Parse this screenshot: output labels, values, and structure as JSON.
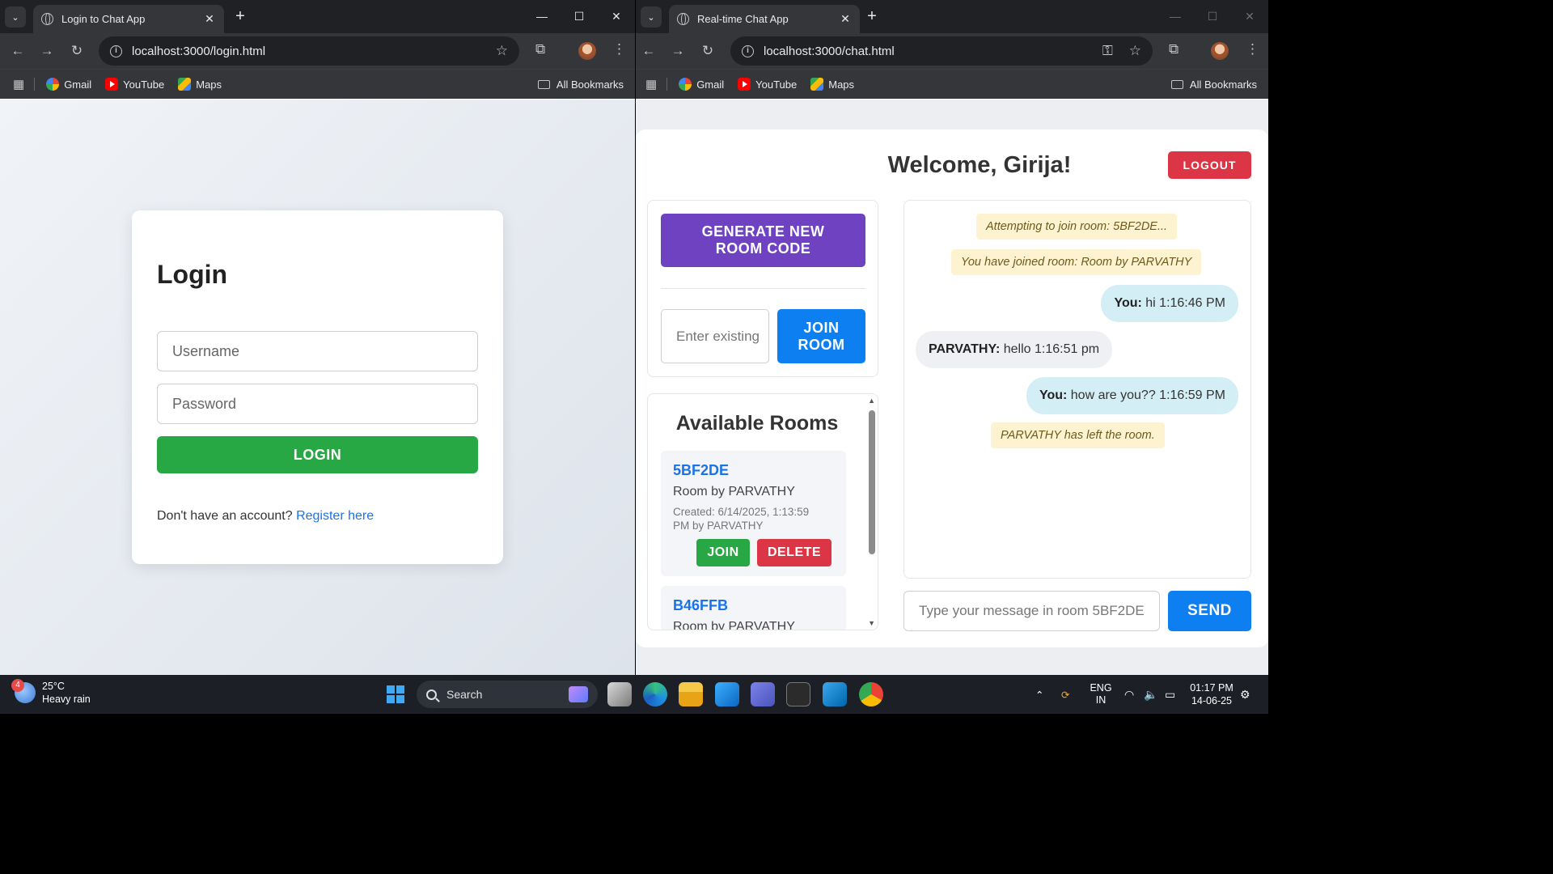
{
  "left_window": {
    "tab_title": "Login to Chat App",
    "url": "localhost:3000/login.html",
    "bookmarks": [
      "Gmail",
      "YouTube",
      "Maps"
    ],
    "all_bookmarks": "All Bookmarks"
  },
  "right_window": {
    "tab_title": "Real-time Chat App",
    "url": "localhost:3000/chat.html",
    "bookmarks": [
      "Gmail",
      "YouTube",
      "Maps"
    ],
    "all_bookmarks": "All Bookmarks"
  },
  "login": {
    "title": "Login",
    "username_placeholder": "Username",
    "password_placeholder": "Password",
    "button": "LOGIN",
    "register_prompt": "Don't have an account?",
    "register_link": "Register here"
  },
  "chat": {
    "welcome": "Welcome, Girija!",
    "logout": "LOGOUT",
    "generate_line1": "GENERATE NEW",
    "generate_line2": "ROOM CODE",
    "room_code_placeholder": "Enter existing",
    "join_room_line1": "JOIN",
    "join_room_line2": "ROOM",
    "rooms_title": "Available Rooms",
    "rooms": [
      {
        "code": "5BF2DE",
        "name": "Room by PARVATHY",
        "meta_line1": "Created: 6/14/2025, 1:13:59",
        "meta_line2": "PM by PARVATHY",
        "join": "JOIN",
        "delete": "DELETE"
      },
      {
        "code": "B46FFB",
        "name": "Room by PARVATHY"
      }
    ],
    "messages": [
      {
        "type": "system",
        "text": "Attempting to join room: 5BF2DE..."
      },
      {
        "type": "system",
        "text": "You have joined room: Room by PARVATHY"
      },
      {
        "type": "own",
        "sender": "You:",
        "text": "hi 1:16:46 PM"
      },
      {
        "type": "other",
        "sender": "PARVATHY:",
        "text": "hello 1:16:51 pm"
      },
      {
        "type": "own",
        "sender": "You:",
        "text": "how are you?? 1:16:59 PM"
      },
      {
        "type": "system",
        "text": "PARVATHY has left the room."
      }
    ],
    "message_placeholder": "Type your message in room 5BF2DE",
    "send": "SEND"
  },
  "taskbar": {
    "weather_badge": "4",
    "weather_temp": "25°C",
    "weather_desc": "Heavy rain",
    "search": "Search",
    "lang_line1": "ENG",
    "lang_line2": "IN",
    "time": "01:17 PM",
    "date": "14-06-25"
  },
  "colors": {
    "login_green": "#28a745",
    "logout_red": "#dc3545",
    "generate_purple": "#6f42c1",
    "action_blue": "#0d7ff0",
    "link_blue": "#1a73e8"
  }
}
